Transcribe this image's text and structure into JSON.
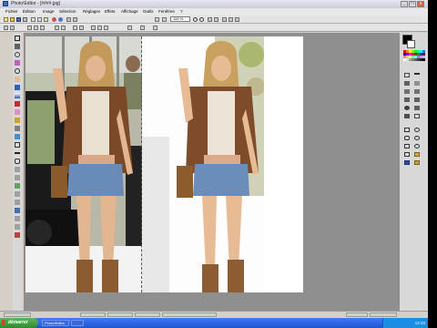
{
  "window": {
    "title": "Photo!Editor - [####.jpg]",
    "minimize_glyph": "_",
    "maximize_glyph": "□",
    "close_glyph": "x"
  },
  "menu": [
    "Fichier",
    "Édition",
    "Image",
    "Sélection",
    "Réglages",
    "Effets",
    "Affichage",
    "Outils",
    "Fenêtres",
    "?"
  ],
  "toolbar": {
    "zoom_value": "100 %"
  },
  "statusbar": {
    "fields": [
      "",
      "",
      "",
      "",
      "",
      "",
      ""
    ]
  },
  "taskbar": {
    "start_label": "démarrer",
    "tasks": [
      "Photo!Editor",
      ""
    ],
    "clock": "14:23"
  },
  "colors": {
    "primary": "#000000",
    "secondary": "#ffffff",
    "taskbar": "#2456d6",
    "start": "#3a9a3a",
    "workspace": "#8f8f8f"
  },
  "icons": {
    "tools": [
      "rectangle-select-icon",
      "move-icon",
      "lasso-icon",
      "magic-wand-icon",
      "zoom-icon",
      "pan-icon",
      "paint-bucket-icon",
      "gradient-icon",
      "brush-icon",
      "eraser-icon",
      "pencil-icon",
      "clone-stamp-icon",
      "recolor-icon",
      "text-icon",
      "line-icon",
      "shapes-icon"
    ],
    "right_tools": [
      "brush-icon",
      "pencil-icon",
      "eraser-icon",
      "fill-icon",
      "spray-icon",
      "stamp-icon",
      "rect-shape-icon",
      "ellipse-shape-icon",
      "rounded-rect-icon",
      "freeform-icon",
      "line-shape-icon",
      "curve-icon",
      "layer-icon",
      "history-icon"
    ]
  }
}
